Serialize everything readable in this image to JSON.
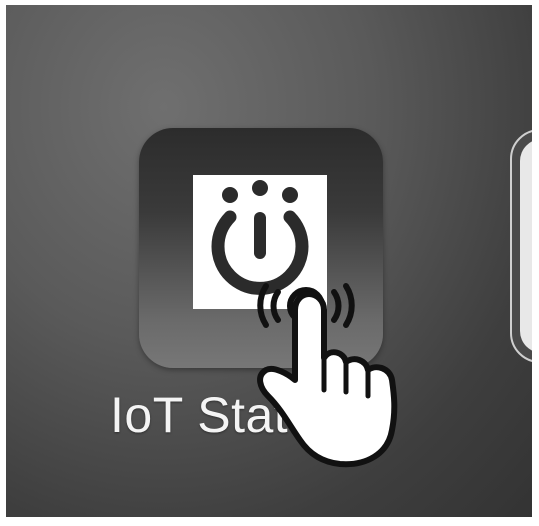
{
  "homescreen": {
    "apps": [
      {
        "label": "IoT Station",
        "icon": "power-dots-logo-icon"
      }
    ]
  },
  "overlay": {
    "gesture_icon": "tap-hand-icon"
  },
  "colors": {
    "background": "#555555",
    "tile": "#3a3a3a",
    "logo_bg": "#ffffff",
    "logo_mark": "#2b2b2b",
    "label": "#f4f4f4"
  }
}
